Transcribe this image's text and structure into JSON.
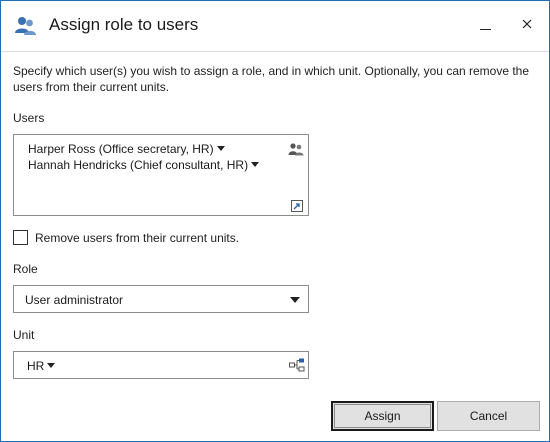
{
  "window": {
    "title": "Assign role to users",
    "title_icon": "users-icon",
    "controls": {
      "minimize": "minimize-icon",
      "close": "close-icon"
    }
  },
  "description": "Specify which user(s) you wish to assign a role, and in which unit. Optionally, you can remove the users from their current units.",
  "users": {
    "label": "Users",
    "items": [
      {
        "text": "Harper Ross (Office secretary, HR)"
      },
      {
        "text": "Hannah Hendricks (Chief consultant, HR)"
      }
    ],
    "picker_icon": "users-picker-icon",
    "browse_icon": "browse-icon"
  },
  "remove_checkbox": {
    "label": "Remove users from their current units.",
    "checked": false
  },
  "role": {
    "label": "Role",
    "selected": "User administrator"
  },
  "unit": {
    "label": "Unit",
    "value": "HR",
    "tree_icon": "org-tree-icon"
  },
  "buttons": {
    "assign": "Assign",
    "cancel": "Cancel"
  }
}
